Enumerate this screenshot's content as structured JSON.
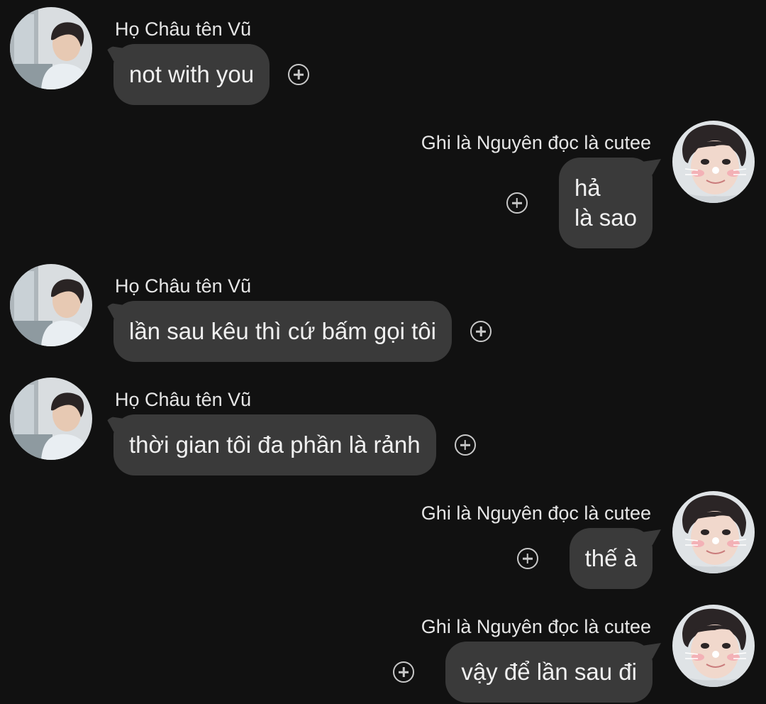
{
  "conversation": {
    "messages": [
      {
        "side": "left",
        "sender": "Họ Châu tên Vũ",
        "text": "not with you",
        "avatar_icon": "avatar-vu"
      },
      {
        "side": "right",
        "sender": "Ghi là Nguyên đọc là cutee",
        "text": "hả\nlà sao",
        "avatar_icon": "avatar-nguyen"
      },
      {
        "side": "left",
        "sender": "Họ Châu tên Vũ",
        "text": "lần sau kêu thì cứ bấm gọi tôi",
        "avatar_icon": "avatar-vu"
      },
      {
        "side": "left",
        "sender": "Họ Châu tên Vũ",
        "text": "thời gian tôi đa phần là rảnh",
        "avatar_icon": "avatar-vu"
      },
      {
        "side": "right",
        "sender": "Ghi là Nguyên đọc là cutee",
        "text": "thế à",
        "avatar_icon": "avatar-nguyen"
      },
      {
        "side": "right",
        "sender": "Ghi là Nguyên đọc là cutee",
        "text": "vậy để lần sau đi",
        "avatar_icon": "avatar-nguyen"
      }
    ],
    "react_icon": "add-reaction-icon"
  },
  "colors": {
    "background": "#111111",
    "bubble": "#3a3a3a",
    "text": "#f0f0f0"
  }
}
